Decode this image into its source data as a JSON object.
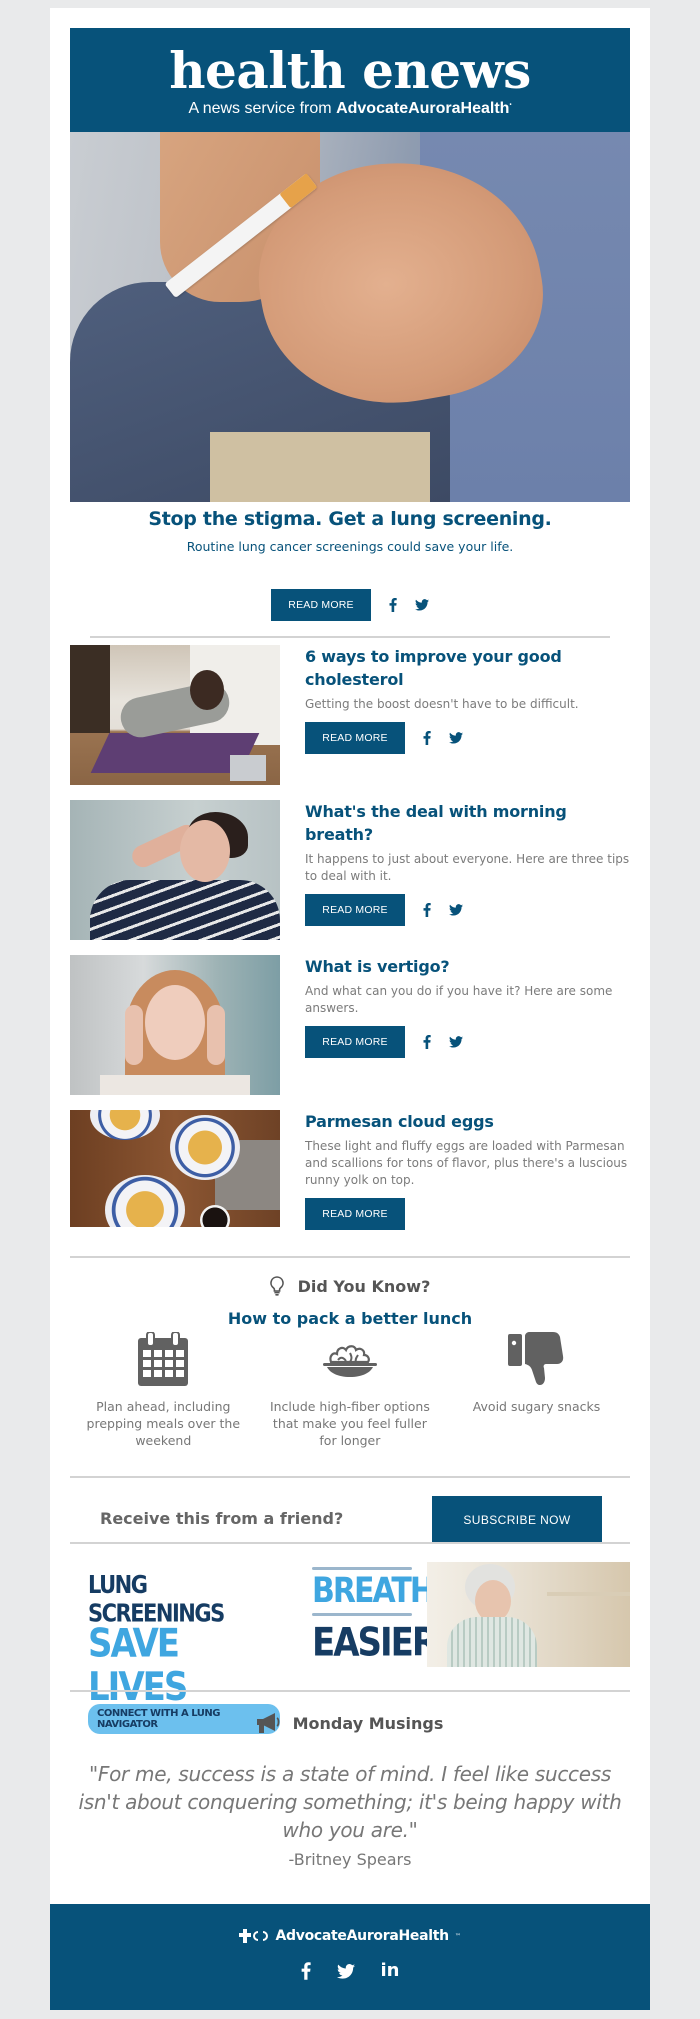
{
  "header": {
    "title": "health enews",
    "subtitle_prefix": "A news service from ",
    "subtitle_brand": "AdvocateAuroraHealth"
  },
  "hero": {
    "image_alt": "Person holding a lit cigarette",
    "title": "Stop the stigma. Get a lung screening.",
    "description": "Routine lung cancer screenings could save your life.",
    "button_label": "READ MORE",
    "share_icons": [
      "facebook-icon",
      "twitter-icon"
    ]
  },
  "articles": [
    {
      "image_alt": "Woman doing a plank on a yoga mat in front of a laptop",
      "title": "6 ways to improve your good cholesterol",
      "description": "Getting the boost doesn't have to be difficult.",
      "button_label": "READ MORE",
      "has_share": true
    },
    {
      "image_alt": "Woman yawning",
      "title": "What's the deal with morning breath?",
      "description": "It happens to just about everyone. Here are three tips to deal with it.",
      "button_label": "READ MORE",
      "has_share": true
    },
    {
      "image_alt": "Woman holding her temples",
      "title": "What is vertigo?",
      "description": "And what can you do if you have it? Here are some answers.",
      "button_label": "READ MORE",
      "has_share": true
    },
    {
      "image_alt": "Parmesan cloud eggs on plates",
      "title": "Parmesan cloud eggs",
      "description": "These light and fluffy eggs are loaded with Parmesan and scallions for tons of flavor, plus there's a luscious runny yolk on top.",
      "button_label": "READ MORE",
      "has_share": false
    }
  ],
  "did_you_know": {
    "label": "Did You Know?",
    "icon": "lightbulb-icon",
    "title": "How to pack a better lunch",
    "tips": [
      {
        "icon": "calendar-icon",
        "text": "Plan ahead, including prepping meals over the weekend"
      },
      {
        "icon": "salad-bowl-icon",
        "text": "Include high-fiber options that make you feel fuller for longer"
      },
      {
        "icon": "thumbs-down-icon",
        "text": "Avoid sugary snacks"
      }
    ]
  },
  "subscribe": {
    "prompt": "Receive this from a friend?",
    "button_label": "SUBSCRIBE NOW"
  },
  "banners": {
    "left": {
      "line1": "LUNG SCREENINGS",
      "line2": "SAVE LIVES",
      "pill": "CONNECT WITH A LUNG NAVIGATOR"
    },
    "right": {
      "line1": "BREATHE",
      "line2": "EASIER",
      "image_alt": "Older woman holding a mug by a window"
    }
  },
  "monday_musings": {
    "label": "Monday Musings",
    "icon": "megaphone-icon",
    "quote": "\"For me, success is a state of mind. I feel like success isn't about conquering something; it's being happy with who you are.\"",
    "author": "-Britney Spears"
  },
  "footer": {
    "brand": "AdvocateAuroraHealth",
    "trademark": "™",
    "social": [
      "facebook-icon",
      "twitter-icon",
      "linkedin-icon"
    ],
    "linkedin_text": "in"
  },
  "colors": {
    "brand_blue": "#07527a",
    "text_gray": "#777777",
    "page_bg": "#e9eaeb",
    "banner_light_blue": "#3fa6e0",
    "banner_navy": "#163c63"
  }
}
